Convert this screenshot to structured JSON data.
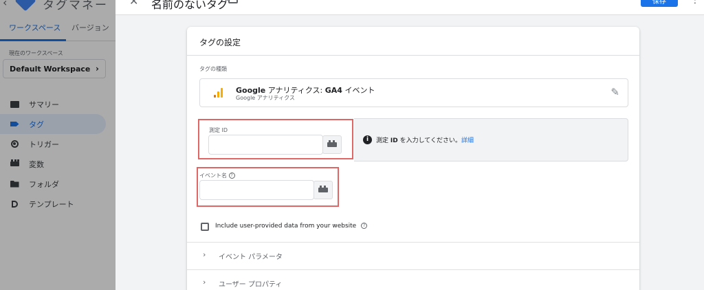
{
  "app": {
    "back_glyph": "‹",
    "name": "タグマネー"
  },
  "workspace_tabs": [
    {
      "label": "ワークスペース",
      "active": true
    },
    {
      "label": "バージョン",
      "active": false
    }
  ],
  "workspace": {
    "label": "現在のワークスペース",
    "name": "Default Workspace",
    "chevron": "›"
  },
  "sidebar": {
    "items": [
      {
        "label": "サマリー",
        "icon": "summary-icon",
        "active": false
      },
      {
        "label": "タグ",
        "icon": "tag-icon",
        "active": true
      },
      {
        "label": "トリガー",
        "icon": "trigger-icon",
        "active": false
      },
      {
        "label": "変数",
        "icon": "variables-icon",
        "active": false
      },
      {
        "label": "フォルダ",
        "icon": "folder-icon",
        "active": false
      },
      {
        "label": "テンプレート",
        "icon": "template-icon",
        "active": false
      }
    ]
  },
  "panel": {
    "close_glyph": "✕",
    "title": "名前のないタグ",
    "save_label": "保存",
    "more_glyph": "⋮"
  },
  "card": {
    "title": "タグの設定",
    "tag_type_label": "タグの種類",
    "tag_type": {
      "name_bold": "Google",
      "name_rest": " アナリティクス: ",
      "name_bold2": "GA4",
      "name_tail": " イベント",
      "subtitle": "Google アナリティクス",
      "edit_glyph": "✎"
    },
    "measurement_id": {
      "label": "測定 ID",
      "value": "",
      "info_prefix": "測定 ",
      "info_bold": "ID",
      "info_suffix": " を入力してください。",
      "info_link": "詳細"
    },
    "event_name": {
      "label": "イベント名",
      "value": ""
    },
    "user_provided_checkbox": {
      "label": "Include user-provided data from your website",
      "checked": false
    },
    "accordions": [
      {
        "label": "イベント パラメータ",
        "chevron": "›"
      },
      {
        "label": "ユーザー プロパティ",
        "chevron": "›"
      }
    ]
  },
  "colors": {
    "accent": "#1a73e8",
    "highlight": "#e06666",
    "ga_orange": "#f9ab00",
    "ga_dark_orange": "#e37400"
  }
}
